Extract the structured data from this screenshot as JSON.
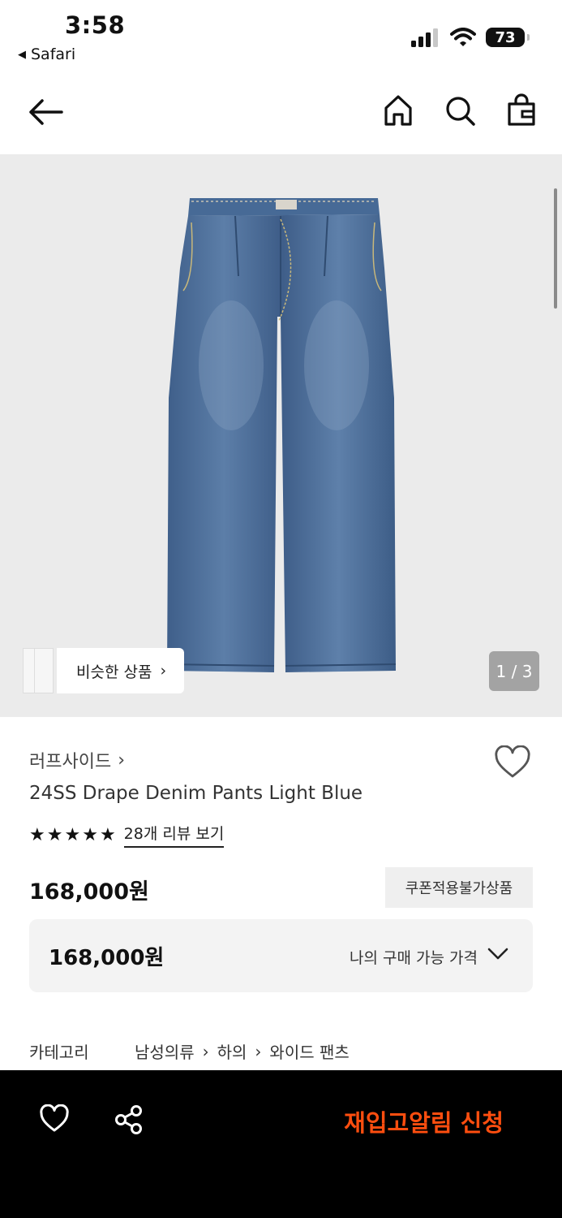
{
  "status_bar": {
    "time": "3:58",
    "back_app": "Safari",
    "battery": "73"
  },
  "nav": {
    "icons": [
      "back-arrow-icon",
      "home-icon",
      "search-icon",
      "shopping-bag-icon"
    ]
  },
  "gallery": {
    "similar_label": "비슷한 상품",
    "page_indicator": "1 / 3"
  },
  "product": {
    "brand": "러프사이드",
    "title": "24SS Drape Denim Pants Light Blue",
    "stars": 5,
    "review_link": "28개 리뷰 보기",
    "price": "168,000원",
    "coupon_badge": "쿠폰적용불가상품",
    "my_price_amount": "168,000원",
    "my_price_label": "나의 구매 가능 가격"
  },
  "category": {
    "label": "카테고리",
    "path": [
      "남성의류",
      "하의",
      "와이드 팬츠"
    ]
  },
  "bottom_bar": {
    "restock_label": "재입고알림 신청"
  },
  "colors": {
    "accent": "#ff4e0f",
    "denim": "#4a6d99",
    "bottom_bar": "#000000"
  }
}
